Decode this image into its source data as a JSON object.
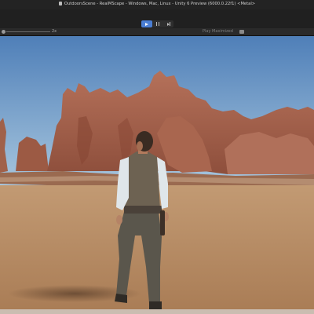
{
  "window": {
    "title": "OutdoorsScene - RealMScape - Windows, Mac, Linux - Unity 6 Preview (6000.0.22f1) <Metal>"
  },
  "toolbar": {
    "play_button": "play-icon",
    "pause_button": "pause-icon",
    "step_button": "step-icon"
  },
  "game_view": {
    "scale_label": "2x",
    "play_mode_label": "Play Maximized"
  },
  "colors": {
    "accent": "#4a7ed4",
    "sky_top": "#4f7fb8",
    "sky_bottom": "#9fc0da",
    "ground": "#b78a63",
    "rock": "#a05c45"
  }
}
